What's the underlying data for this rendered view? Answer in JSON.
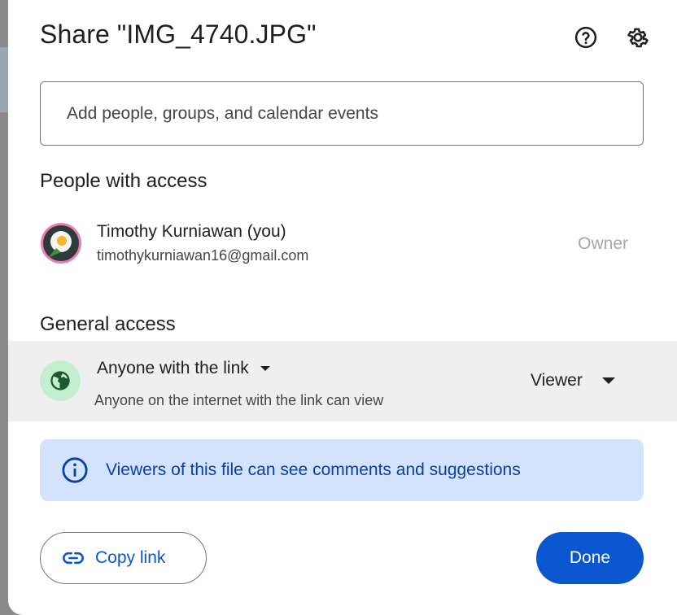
{
  "dialog": {
    "title": "Share \"IMG_4740.JPG\"",
    "help_icon": "help-circle-icon",
    "settings_icon": "gear-icon"
  },
  "add_people": {
    "placeholder": "Add people, groups, and calendar events",
    "value": ""
  },
  "people_with_access": {
    "heading": "People with access",
    "users": [
      {
        "name": "Timothy Kurniawan (you)",
        "email": "timothykurniawan16@gmail.com",
        "role": "Owner"
      }
    ]
  },
  "general_access": {
    "heading": "General access",
    "link_setting": "Anyone with the link",
    "description": "Anyone on the internet with the link can view",
    "role": "Viewer",
    "icon": "globe-icon"
  },
  "info_banner": {
    "text": "Viewers of this file can see comments and suggestions",
    "icon": "info-icon"
  },
  "actions": {
    "copy_link_label": "Copy link",
    "copy_link_icon": "link-icon",
    "done_label": "Done"
  },
  "colors": {
    "primary": "#0b57d0",
    "info_bg": "#d3e3fd",
    "info_text": "#0842a0",
    "access_row_bg": "#efefef",
    "globe_bg": "#c4eed0"
  }
}
